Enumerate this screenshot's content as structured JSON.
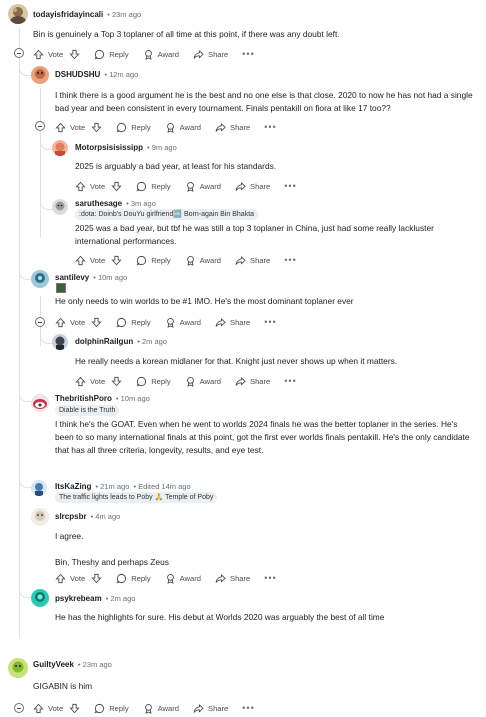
{
  "actions": {
    "vote": "Vote",
    "reply": "Reply",
    "award": "Award",
    "share": "Share",
    "more": "•••"
  },
  "comments": [
    {
      "username": "todayisfridayincali",
      "time": "23m ago",
      "body": [
        "Bin is genuinely a Top 3 toplaner of all time at this point, if there was any doubt left."
      ]
    },
    {
      "username": "DSHUDSHU",
      "time": "12m ago",
      "body": [
        "I think there is a good argument he is the best and no one else is that close. 2020 to now he has not had a single bad year and been consistent in every tournament. Finals pentakill on fiora at like 17 too??"
      ]
    },
    {
      "username": "Motorpsisisissipp",
      "time": "9m ago",
      "body": [
        "2025 is arguably a bad year, at least for his standards."
      ]
    },
    {
      "username": "saruthesage",
      "time": "3m ago",
      "flair": ":dota: Doinb's DouYu girlfriend🆒 Born-again Bin Bhakta",
      "body": [
        "2025 was a bad year, but tbf he was still a top 3 toplaner in China, just had some really lackluster international performances."
      ]
    },
    {
      "username": "santilevy",
      "time": "10m ago",
      "body": [
        "He only needs to win worlds to be #1 IMO. He's the most dominant toplaner ever"
      ]
    },
    {
      "username": "dolphinRailgun",
      "time": "2m ago",
      "body": [
        "He really needs a korean midlaner for that. Knight just never shows up when it matters."
      ]
    },
    {
      "username": "ThebritishPoro",
      "time": "10m ago",
      "flair": "Diable is the Truth",
      "body": [
        "I think he's the GOAT. Even when he went to worlds 2024 finals he was the better toplaner in the series. He's been to so many international finals at this point, got the first ever worlds finals pentakill. He's the only candidate that has all three criteria, longevity, results, and eye test."
      ]
    },
    {
      "username": "ItsKaZing",
      "time": "21m ago",
      "edited": "Edited 14m ago",
      "flair": "The traffic lights leads to Poby 🙏 Temple of Poby"
    },
    {
      "username": "slrcpsbr",
      "time": "4m ago",
      "body": [
        "I agree.",
        "Bin, Theshy and perhaps Zeus"
      ]
    },
    {
      "username": "psykrebeam",
      "time": "2m ago",
      "body": [
        "He has the highlights for sure. His debut at Worlds 2020 was arguably the best of all time"
      ]
    },
    {
      "username": "GuiltyVeek",
      "time": "23m ago",
      "body": [
        "GIGABIN is him"
      ]
    }
  ]
}
